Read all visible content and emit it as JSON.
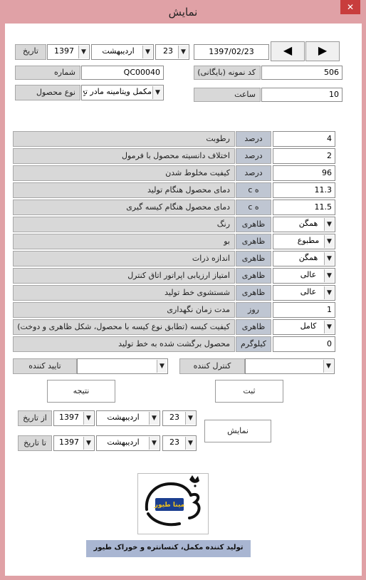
{
  "window": {
    "title": "نمایش",
    "close": "✕"
  },
  "header": {
    "date_label": "تاریخ",
    "year": "1397",
    "month": "اردیبهشت",
    "day": "23",
    "date_value": "1397/02/23",
    "number_label": "شماره",
    "number_value": "QC00040",
    "sample_code_label": "کد نمونه (بایگانی)",
    "sample_code_value": "506",
    "product_type_label": "نوع محصول",
    "product_type_value": "مکمل ویتامینه مادر تخ",
    "hour_label": "ساعت",
    "hour_value": "10"
  },
  "params": [
    {
      "label": "رطوبت",
      "unit": "درصد",
      "value": "4"
    },
    {
      "label": "اختلاف دانسیته محصول با فرمول",
      "unit": "درصد",
      "value": "2"
    },
    {
      "label": "کیفیت مخلوط شدن",
      "unit": "درصد",
      "value": "96"
    },
    {
      "label": "دمای محصول هنگام تولید",
      "unit": "c ه",
      "value": "11.3"
    },
    {
      "label": "دمای محصول هنگام کیسه گیری",
      "unit": "c ه",
      "value": "11.5"
    },
    {
      "label": "رنگ",
      "unit": "ظاهری",
      "value": "همگن"
    },
    {
      "label": "بو",
      "unit": "ظاهری",
      "value": "مطبوع"
    },
    {
      "label": "اندازه ذرات",
      "unit": "ظاهری",
      "value": "همگن"
    },
    {
      "label": "امتیاز ارزیابی اپراتور اتاق کنترل",
      "unit": "ظاهری",
      "value": "عالی"
    },
    {
      "label": "شستشوی خط تولید",
      "unit": "ظاهری",
      "value": "عالی"
    },
    {
      "label": "مدت زمان نگهداری",
      "unit": "روز",
      "value": "1"
    },
    {
      "label": "کیفیت کیسه (تطابق نوع کیسه با محصول، شکل ظاهری و دوخت)",
      "unit": "ظاهری",
      "value": "کامل"
    },
    {
      "label": "محصول برگشت شده به خط تولید",
      "unit": "کیلوگرم",
      "value": "0"
    }
  ],
  "approval": {
    "approver_label": "تایید کننده",
    "controller_label": "کنترل کننده"
  },
  "buttons": {
    "result": "نتیجه",
    "register": "ثبت",
    "show": "نمایش",
    "prev": "◀",
    "next": "▶"
  },
  "range": {
    "from_label": "از تاریخ",
    "to_label": "تا تاریخ",
    "from_year": "1397",
    "from_month": "اردیبهشت",
    "from_day": "23",
    "to_year": "1397",
    "to_month": "اردیبهشت",
    "to_day": "23"
  },
  "footer": {
    "logo_text": "مینا طیور",
    "tagline": "تولید کننده مکمل، کنسانتره و خوراک طیور"
  },
  "dropdown_arrow": "▼",
  "colors": {
    "frame": "#e0a1a6",
    "label_bg": "#d8d8d8",
    "unit_bg": "#bfc6d2",
    "tag_bg": "#a9b6d2",
    "logo_blue": "#1c3f8f",
    "logo_yellow": "#f1c21b"
  }
}
